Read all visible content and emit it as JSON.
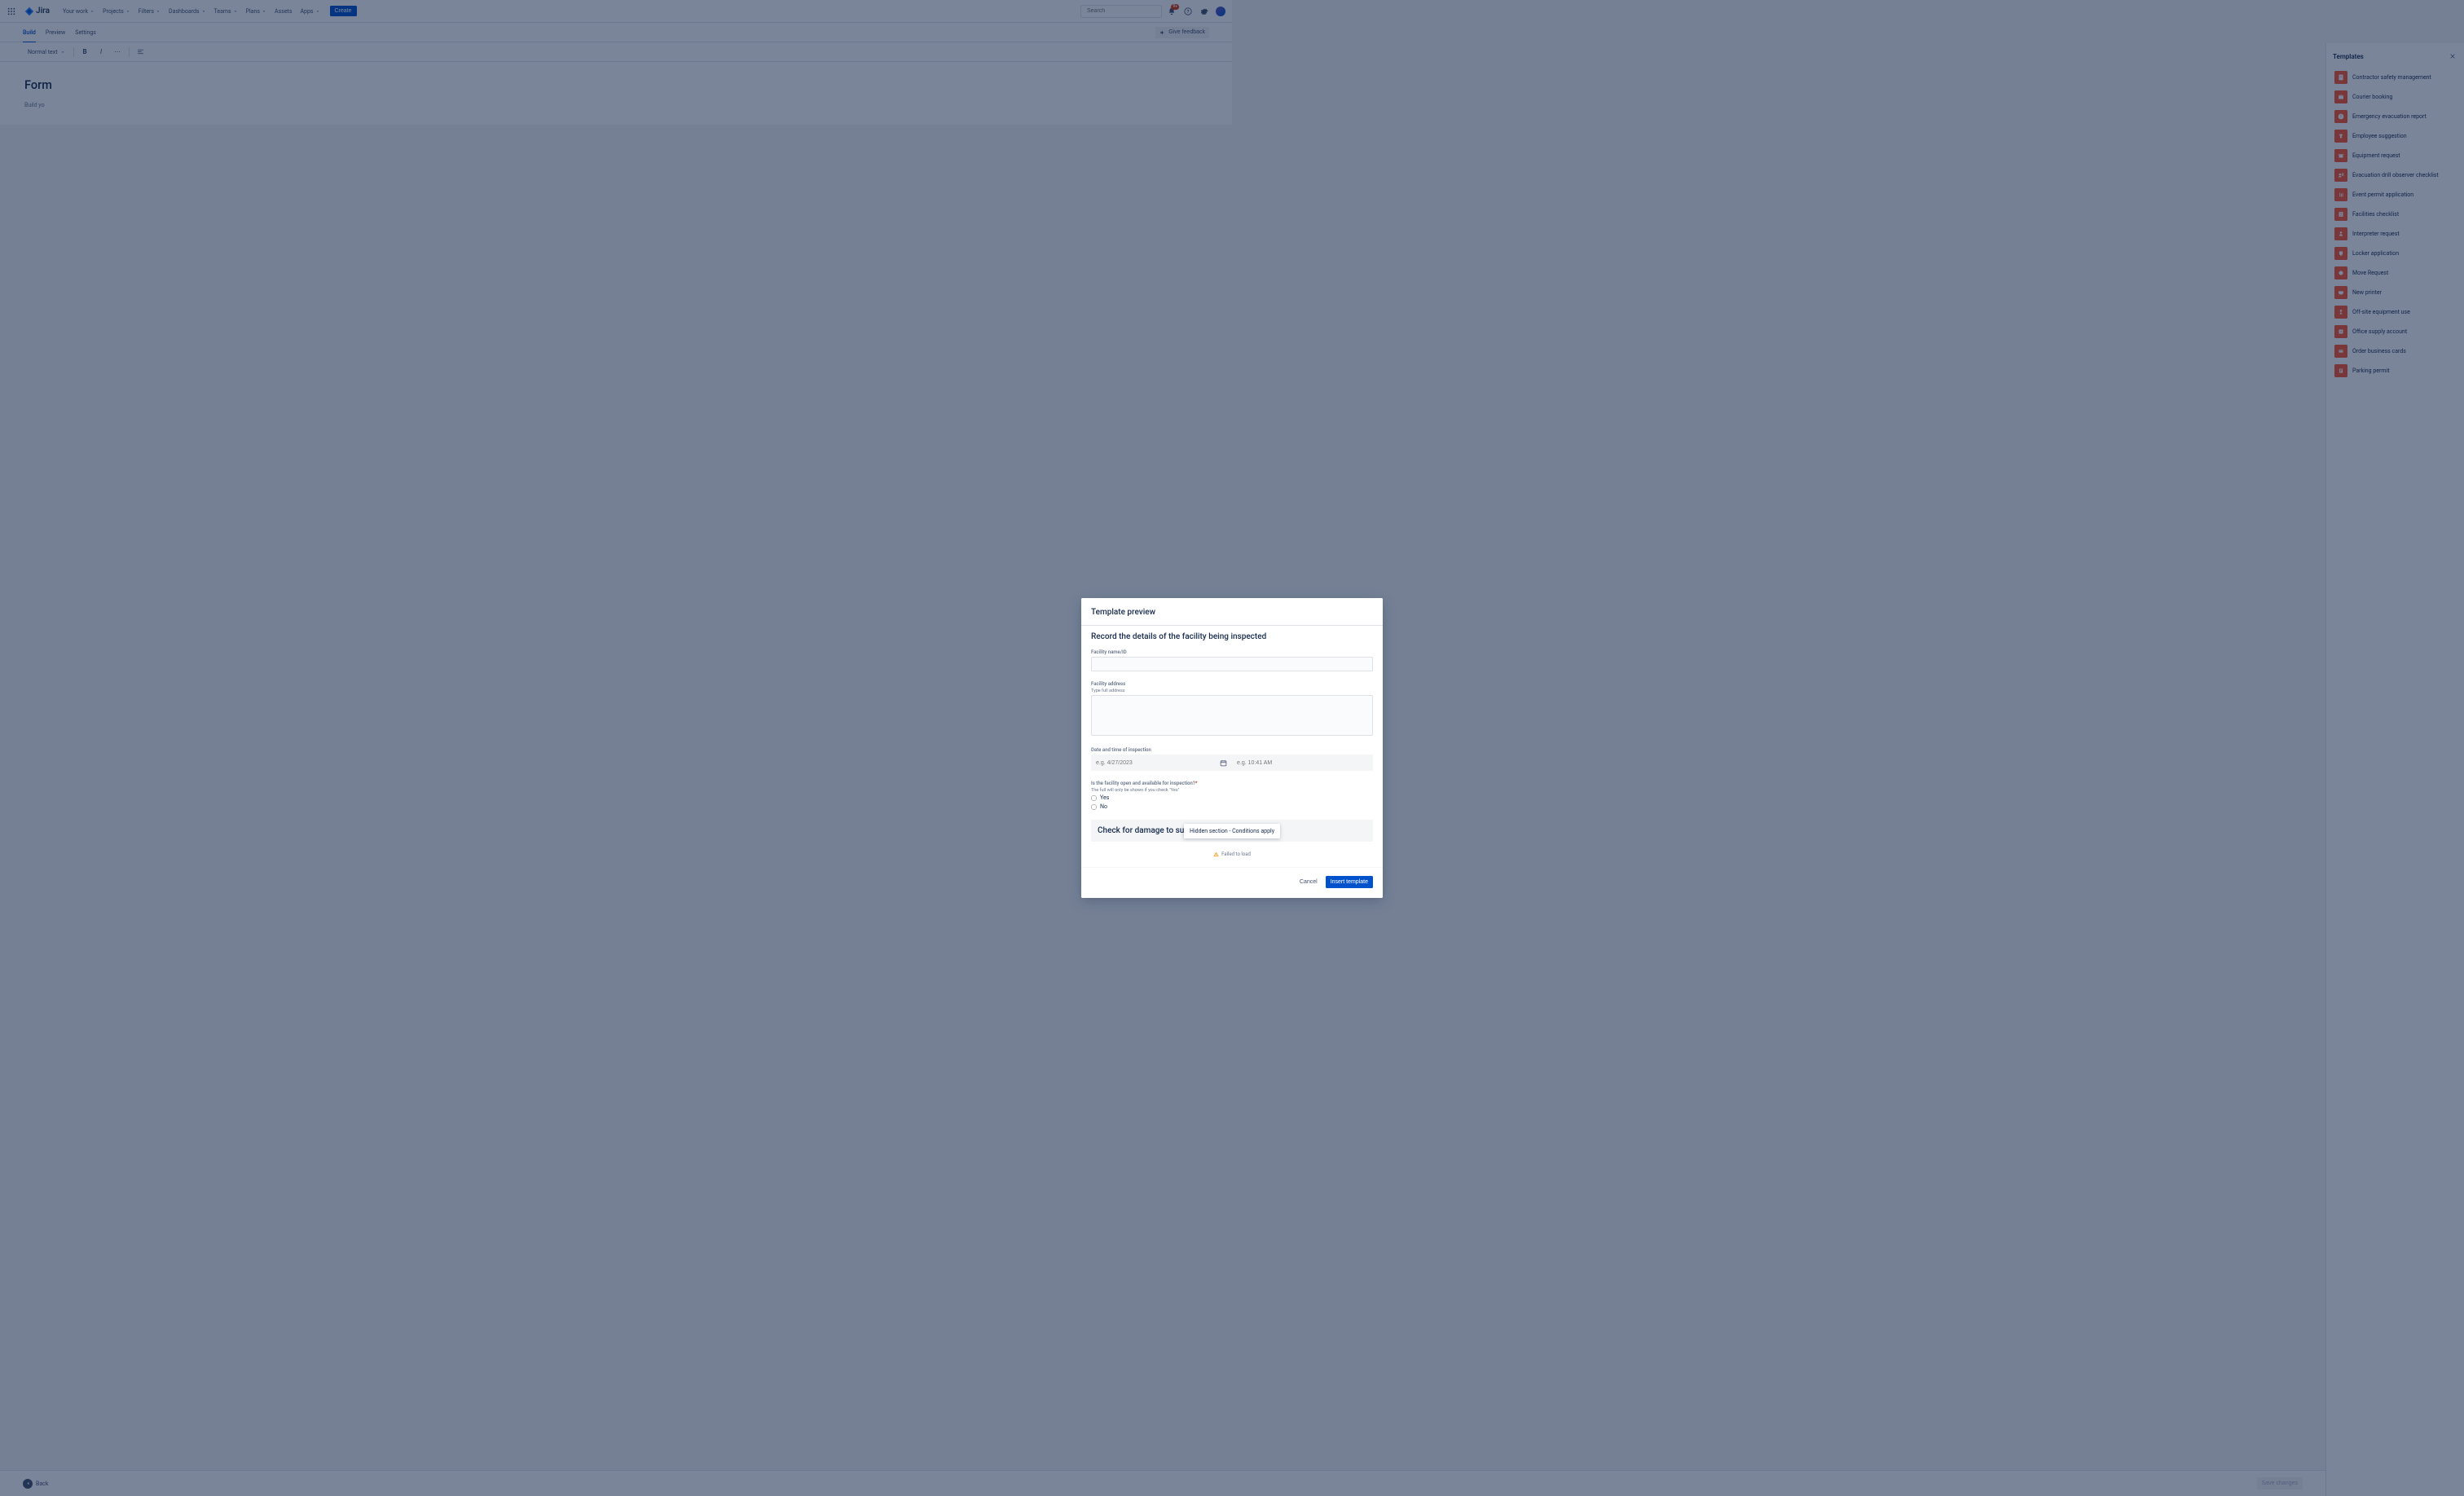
{
  "app": {
    "name": "Jira"
  },
  "nav": {
    "items": [
      "Your work",
      "Projects",
      "Filters",
      "Dashboards",
      "Teams",
      "Plans",
      "Assets",
      "Apps"
    ],
    "has_dropdown": [
      true,
      true,
      true,
      true,
      true,
      true,
      false,
      true
    ],
    "create": "Create",
    "search_placeholder": "Search",
    "notification_badge": "9+"
  },
  "tabs": {
    "items": [
      "Build",
      "Preview",
      "Settings"
    ],
    "active": 0,
    "feedback": "Give feedback"
  },
  "toolbar": {
    "text_style": "Normal text"
  },
  "editor": {
    "title": "Form",
    "hint": "Build yo"
  },
  "templates": {
    "heading": "Templates",
    "items": [
      {
        "label": "Contractor safety management",
        "color": "#ff5630"
      },
      {
        "label": "Courier booking",
        "color": "#ff5630"
      },
      {
        "label": "Emergency evacuation report",
        "color": "#ff5630"
      },
      {
        "label": "Employee suggestion",
        "color": "#ff5630"
      },
      {
        "label": "Equipment request",
        "color": "#ff5630"
      },
      {
        "label": "Evacuation drill observer checklist",
        "color": "#ff5630"
      },
      {
        "label": "Event permit application",
        "color": "#ff5630"
      },
      {
        "label": "Facilities checklist",
        "color": "#ff5630"
      },
      {
        "label": "Interpreter request",
        "color": "#ff5630"
      },
      {
        "label": "Locker application",
        "color": "#ff5630"
      },
      {
        "label": "Move Request",
        "color": "#ff5630"
      },
      {
        "label": "New printer",
        "color": "#ff5630"
      },
      {
        "label": "Off-site equipment use",
        "color": "#ff5630"
      },
      {
        "label": "Office supply account",
        "color": "#ff5630"
      },
      {
        "label": "Order business cards",
        "color": "#ff5630"
      },
      {
        "label": "Parking permit",
        "color": "#ff5630"
      }
    ]
  },
  "bottombar": {
    "back": "Back",
    "save": "Save changes"
  },
  "modal": {
    "title": "Template preview",
    "section_title": "Record the details of the facility being inspected",
    "facility_name_label": "Facility name/ID",
    "facility_address_label": "Facility address",
    "facility_address_hint": "Type full address",
    "datetime_label": "Date and time of inspection",
    "date_placeholder": "e.g. 4/27/2023",
    "time_placeholder": "e.g. 10:41 AM",
    "open_question_label": "Is the facility open and available for inspection?",
    "open_question_hint": "The full will only be shown if you check \"Yes\"",
    "radio_yes": "Yes",
    "radio_no": "No",
    "hidden_title": "Check for damage to surf",
    "tooltip": "Hidden section - Conditions apply",
    "failed": "Failed to load",
    "cancel": "Cancel",
    "insert": "Insert template"
  }
}
